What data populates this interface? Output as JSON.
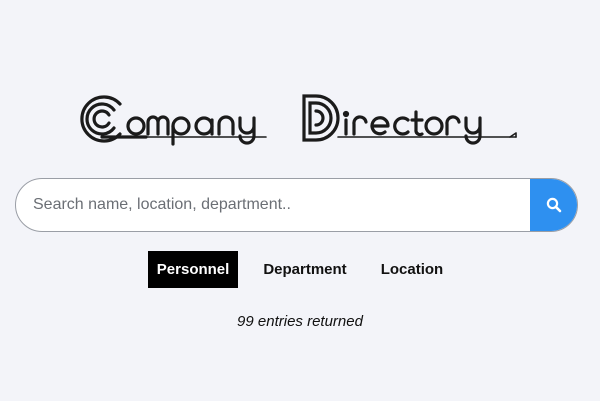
{
  "logo": {
    "text": "Company Directory"
  },
  "search": {
    "placeholder": "Search name, location, department..",
    "value": "",
    "button_icon": "search-icon",
    "button_color": "#2e90f0"
  },
  "tabs": [
    {
      "label": "Personnel",
      "active": true
    },
    {
      "label": "Department",
      "active": false
    },
    {
      "label": "Location",
      "active": false
    }
  ],
  "status": {
    "text": "99 entries returned"
  },
  "colors": {
    "background": "#f3f4f9",
    "active_tab_bg": "#000000",
    "accent": "#2e90f0"
  }
}
